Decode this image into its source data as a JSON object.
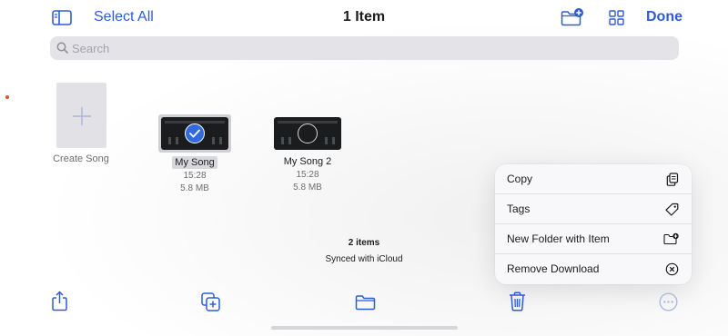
{
  "header": {
    "select_all": "Select All",
    "title": "1 Item",
    "done": "Done"
  },
  "search": {
    "placeholder": "Search"
  },
  "create_song": {
    "label": "Create Song"
  },
  "songs": [
    {
      "name": "My Song",
      "time": "15:28",
      "size": "5.8 MB",
      "selected": true
    },
    {
      "name": "My Song 2",
      "time": "15:28",
      "size": "5.8 MB",
      "selected": false
    }
  ],
  "footer": {
    "count": "2 items",
    "sync_status": "Synced with iCloud"
  },
  "context_menu": {
    "items": [
      {
        "label": "Copy",
        "icon": "copy-icon"
      },
      {
        "label": "Tags",
        "icon": "tag-icon"
      },
      {
        "label": "New Folder with Item",
        "icon": "folder-badge-plus-icon"
      },
      {
        "label": "Remove Download",
        "icon": "x-circle-icon"
      }
    ]
  },
  "colors": {
    "accent": "#2f5cd6",
    "check": "#2f6bdc",
    "search_bg": "#e3e3e8"
  }
}
